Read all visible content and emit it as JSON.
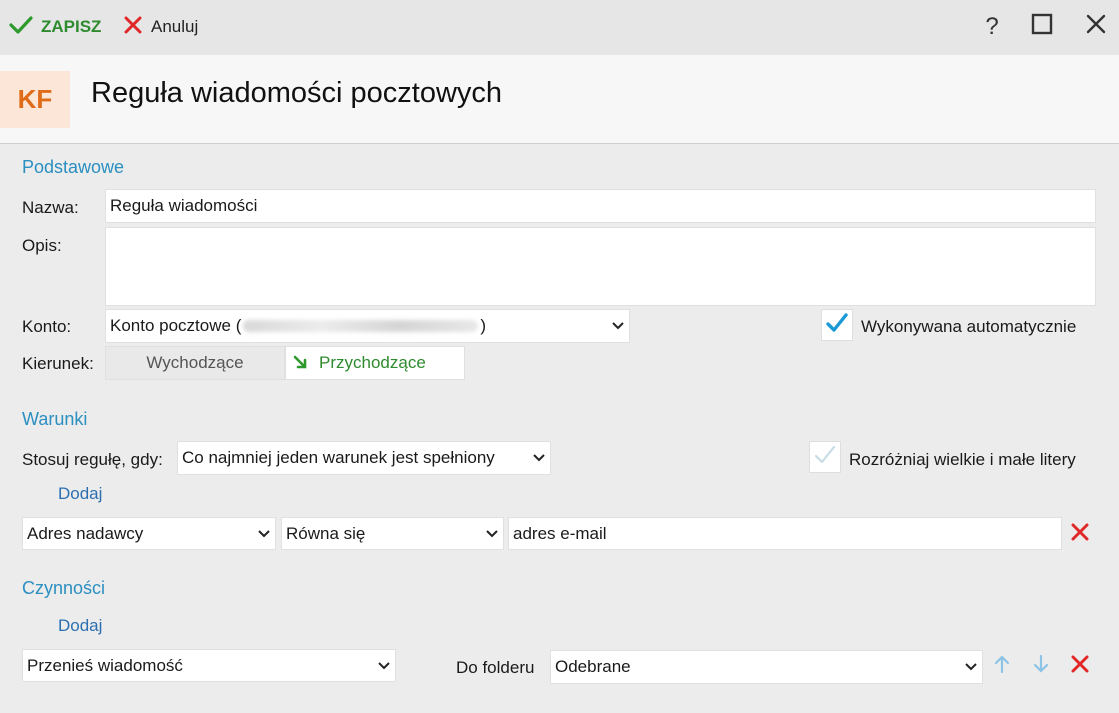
{
  "toolbar": {
    "save_label": "ZAPISZ",
    "cancel_label": "Anuluj",
    "help_label": "?"
  },
  "header": {
    "logo_text": "KF",
    "title": "Reguła wiadomości pocztowych"
  },
  "basic": {
    "section_title": "Podstawowe",
    "name_label": "Nazwa:",
    "name_value": "Reguła wiadomości",
    "description_label": "Opis:",
    "description_value": "",
    "account_label": "Konto:",
    "account_prefix": "Konto pocztowe (",
    "account_suffix": ")",
    "auto_label": "Wykonywana automatycznie",
    "auto_checked": true,
    "direction_label": "Kierunek:",
    "direction_outgoing": "Wychodzące",
    "direction_incoming": "Przychodzące",
    "direction_selected": "Przychodzące"
  },
  "conditions": {
    "section_title": "Warunki",
    "apply_label": "Stosuj regułę, gdy:",
    "apply_value": "Co najmniej jeden warunek jest spełniony",
    "case_label": "Rozróżniaj wielkie i małe litery",
    "case_checked": false,
    "add_label": "Dodaj",
    "rows": [
      {
        "field": "Adres nadawcy",
        "operator": "Równa się",
        "value": "adres e-mail"
      }
    ]
  },
  "actions": {
    "section_title": "Czynności",
    "add_label": "Dodaj",
    "rows": [
      {
        "action": "Przenieś wiadomość",
        "target_label": "Do folderu",
        "target_value": "Odebrane"
      }
    ]
  },
  "colors": {
    "accent": "#2b8fc0",
    "save_green": "#2e8b2e",
    "delete_red": "#e02828",
    "logo_orange": "#e06c1a",
    "check_blue": "#1a9ad6"
  }
}
